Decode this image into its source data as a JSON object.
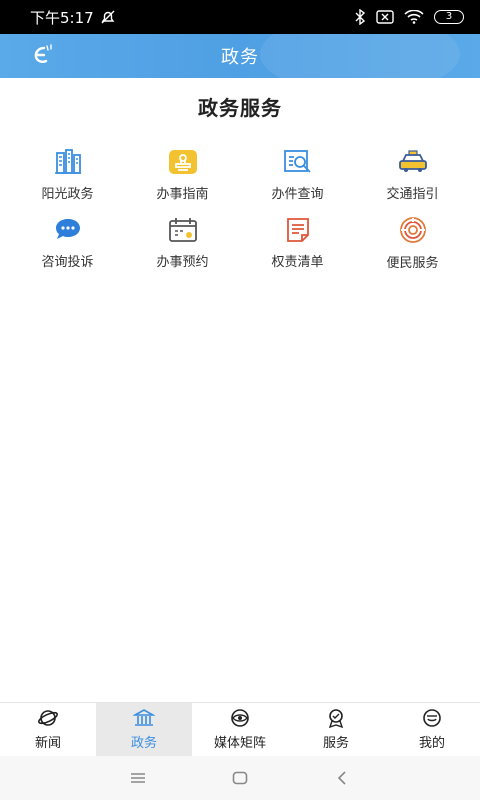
{
  "status_bar": {
    "time": "下午5:17",
    "battery": "3"
  },
  "header": {
    "title": "政务"
  },
  "section": {
    "title": "政务服务"
  },
  "services": [
    {
      "label": "阳光政务",
      "icon": "buildings-icon",
      "color": "#3a8ee0"
    },
    {
      "label": "办事指南",
      "icon": "stamp-icon",
      "color": "#f2c230"
    },
    {
      "label": "办件查询",
      "icon": "search-document-icon",
      "color": "#3a8ee0"
    },
    {
      "label": "交通指引",
      "icon": "taxi-icon",
      "color": "#3a5c9a"
    },
    {
      "label": "咨询投诉",
      "icon": "chat-bubble-icon",
      "color": "#2d7fd9"
    },
    {
      "label": "办事预约",
      "icon": "calendar-icon",
      "color": "#555555"
    },
    {
      "label": "权责清单",
      "icon": "list-document-icon",
      "color": "#e0553a"
    },
    {
      "label": "便民服务",
      "icon": "fingerprint-spiral-icon",
      "color": "#e07a3a"
    }
  ],
  "tabs": [
    {
      "label": "新闻",
      "icon": "planet-icon",
      "active": false
    },
    {
      "label": "政务",
      "icon": "government-building-icon",
      "active": true
    },
    {
      "label": "媒体矩阵",
      "icon": "media-eye-icon",
      "active": false
    },
    {
      "label": "服务",
      "icon": "award-icon",
      "active": false
    },
    {
      "label": "我的",
      "icon": "chat-smile-icon",
      "active": false
    }
  ],
  "colors": {
    "accent": "#3a8ee0",
    "header": "#4f9fe4"
  }
}
